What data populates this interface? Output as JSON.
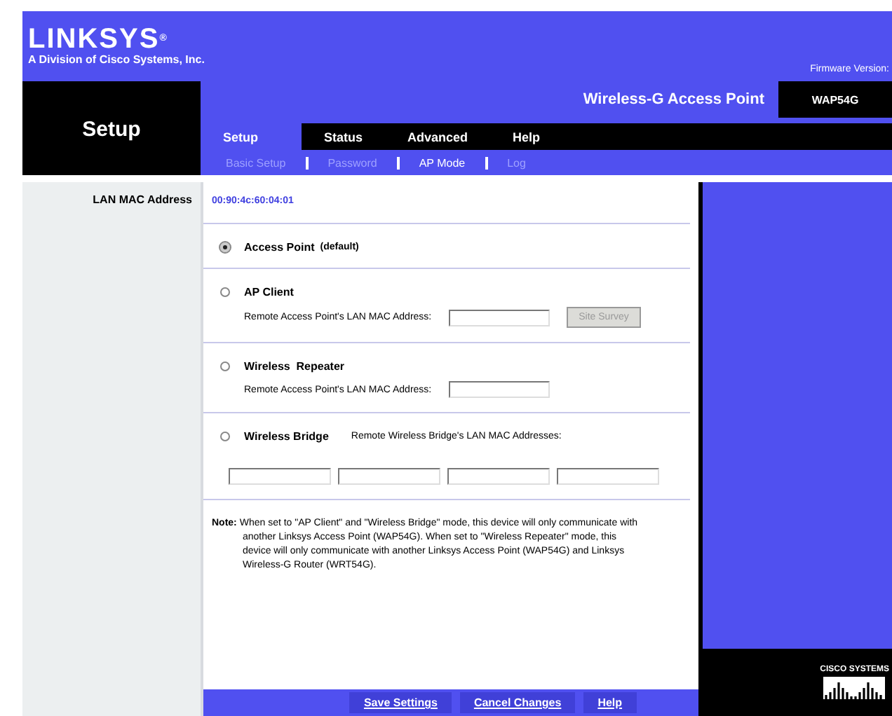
{
  "brand": {
    "logo": "LINKSYS",
    "registered": "®",
    "tagline": "A Division of Cisco Systems, Inc.",
    "firmware": "Firmware Version:"
  },
  "section": "Setup",
  "product": {
    "name": "Wireless-G Access Point",
    "model": "WAP54G"
  },
  "tabs": [
    {
      "label": "Setup",
      "selected": true
    },
    {
      "label": "Status",
      "selected": false
    },
    {
      "label": "Advanced",
      "selected": false
    },
    {
      "label": "Help",
      "selected": false
    }
  ],
  "subtabs": [
    {
      "label": "Basic Setup",
      "selected": false
    },
    {
      "label": "Password",
      "selected": false
    },
    {
      "label": "AP Mode",
      "selected": true
    },
    {
      "label": "Log",
      "selected": false
    }
  ],
  "mac": {
    "label": "LAN MAC Address",
    "value": "00:90:4c:60:04:01"
  },
  "modes": [
    {
      "kind": "plain",
      "label": "Access Point",
      "suffix": "(default)",
      "selected": true
    },
    {
      "kind": "client",
      "label": "AP Client",
      "field_label": "Remote Access Point's LAN MAC Address:",
      "button": "Site Survey",
      "selected": false
    },
    {
      "kind": "repeater",
      "label": "Wireless  Repeater",
      "field_label": "Remote Access Point's LAN MAC Address:",
      "selected": false
    },
    {
      "kind": "bridge",
      "label": "Wireless Bridge",
      "field_label": "Remote Wireless Bridge's LAN MAC Addresses:",
      "selected": false
    }
  ],
  "note": "**Note:** When set to \"AP Client\" and \"Wireless Bridge\" mode, this device will only communicate with another Linksys Access Point (WAP54G). When set to \"Wireless Repeater\" mode, this device will only communicate with another Linksys Access Point (WAP54G) and Linksys Wireless-G Router (WRT54G).",
  "buttons": [
    "Save Settings",
    "Cancel Changes",
    "Help"
  ],
  "cisco": "CISCO SYSTEMS"
}
